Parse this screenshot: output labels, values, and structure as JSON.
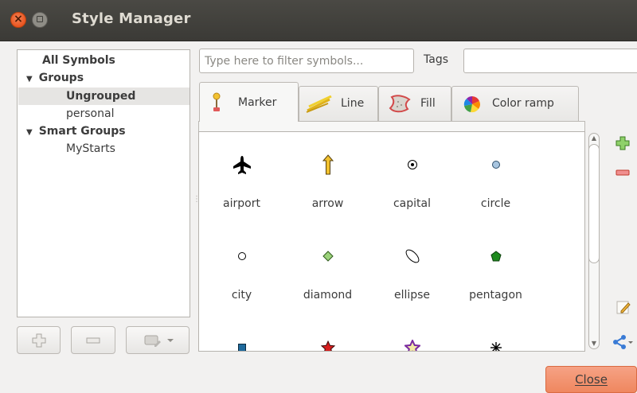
{
  "window": {
    "title": "Style Manager"
  },
  "groups_tree": {
    "items": [
      {
        "label": "All Symbols"
      },
      {
        "label": "Groups",
        "expanded": true
      },
      {
        "label": "Ungrouped",
        "selected": true
      },
      {
        "label": "personal"
      },
      {
        "label": "Smart Groups",
        "expanded": true
      },
      {
        "label": "MyStarts"
      }
    ]
  },
  "filter": {
    "placeholder": "Type here to filter symbols...",
    "value": ""
  },
  "tags": {
    "label": "Tags",
    "value": ""
  },
  "tabs": [
    {
      "label": "Marker",
      "icon": "marker-icon",
      "active": true
    },
    {
      "label": "Line",
      "icon": "line-icon"
    },
    {
      "label": "Fill",
      "icon": "fill-icon"
    },
    {
      "label": "Color ramp",
      "icon": "color-ramp-icon"
    }
  ],
  "symbols": [
    {
      "name": "airport",
      "icon": "airport-icon"
    },
    {
      "name": "arrow",
      "icon": "arrow-icon"
    },
    {
      "name": "capital",
      "icon": "capital-icon"
    },
    {
      "name": "circle",
      "icon": "circle-icon"
    },
    {
      "name": "city",
      "icon": "city-icon"
    },
    {
      "name": "diamond",
      "icon": "diamond-icon"
    },
    {
      "name": "ellipse",
      "icon": "ellipse-icon"
    },
    {
      "name": "pentagon",
      "icon": "pentagon-icon"
    },
    {
      "name": "",
      "icon": "square-icon"
    },
    {
      "name": "",
      "icon": "star-icon"
    },
    {
      "name": "",
      "icon": "star-outline-icon"
    },
    {
      "name": "",
      "icon": "asterisk-icon"
    }
  ],
  "buttons": {
    "close_label": "Close"
  },
  "colors": {
    "titlebar": "#3b3a36",
    "close_accent": "#ef875f",
    "add_green": "#4a9a2e",
    "remove_red": "#d9534f"
  }
}
